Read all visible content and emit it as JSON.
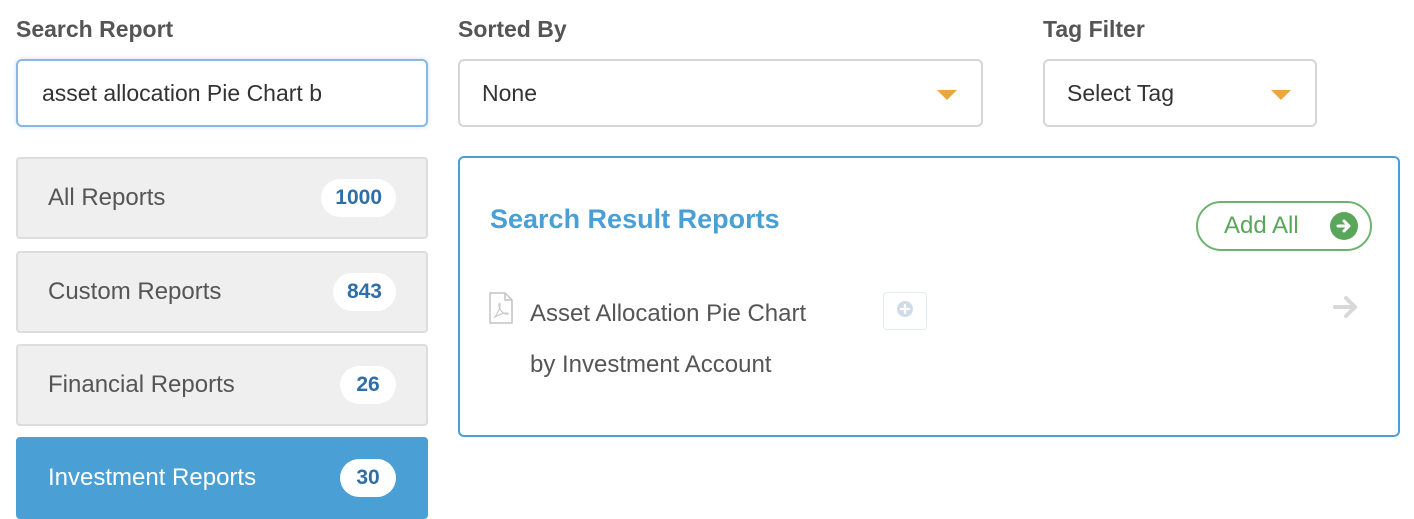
{
  "search": {
    "label": "Search Report",
    "value": "asset allocation Pie Chart b"
  },
  "sort": {
    "label": "Sorted By",
    "selected": "None",
    "icon": "caret-down-icon"
  },
  "tag_filter": {
    "label": "Tag Filter",
    "selected": "Select Tag",
    "icon": "caret-down-icon"
  },
  "categories": [
    {
      "label": "All Reports",
      "count": "1000",
      "active": false
    },
    {
      "label": "Custom Reports",
      "count": "843",
      "active": false
    },
    {
      "label": "Financial Reports",
      "count": "26",
      "active": false
    },
    {
      "label": "Investment Reports",
      "count": "30",
      "active": true
    }
  ],
  "results": {
    "title": "Search Result Reports",
    "add_all_label": "Add All",
    "items": [
      {
        "title_line1": "Asset Allocation Pie Chart",
        "title_line2": "by Investment Account",
        "file_icon": "pdf-file-icon",
        "add_icon": "plus-circle-icon",
        "open_icon": "arrow-right-icon"
      }
    ]
  },
  "colors": {
    "accent_blue": "#4a9fd4",
    "count_blue": "#2f6ea6",
    "green": "#5aa65a",
    "caret_orange": "#e8a83e"
  }
}
